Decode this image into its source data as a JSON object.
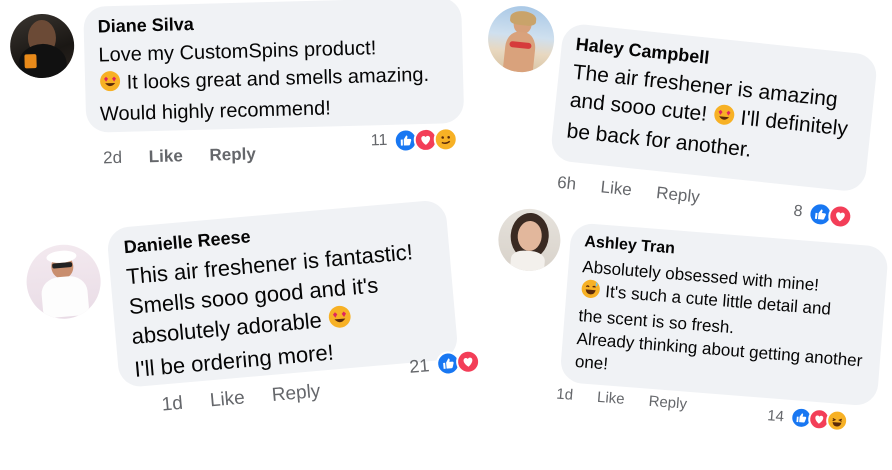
{
  "comments": [
    {
      "name": "Diane Silva",
      "lines": [
        "Love my CustomSpins product!",
        " It looks great and smells amazing.",
        "Would highly recommend!"
      ],
      "time": "2d",
      "like_label": "Like",
      "reply_label": "Reply",
      "reaction_count": "11",
      "reactions": [
        "like",
        "love",
        "wow"
      ]
    },
    {
      "name": "Haley Campbell",
      "lines": [
        "The air freshener is amazing",
        "and sooo cute! ",
        " I'll definitely",
        "be back for another."
      ],
      "time": "6h",
      "like_label": "Like",
      "reply_label": "Reply",
      "reaction_count": "8",
      "reactions": [
        "like",
        "love"
      ]
    },
    {
      "name": "Danielle Reese",
      "lines": [
        "This air freshener is fantastic!",
        "Smells sooo good and it's",
        "absolutely adorable ",
        "I'll be ordering more!"
      ],
      "time": "1d",
      "like_label": "Like",
      "reply_label": "Reply",
      "reaction_count": "21",
      "reactions": [
        "like",
        "love"
      ]
    },
    {
      "name": "Ashley Tran",
      "lines": [
        "Absolutely obsessed with mine!",
        " It's such a cute little detail and",
        "the scent is so fresh.",
        "Already thinking about getting another",
        "one!"
      ],
      "time": "1d",
      "like_label": "Like",
      "reply_label": "Reply",
      "reaction_count": "14",
      "reactions": [
        "like",
        "love",
        "haha"
      ]
    }
  ],
  "colors": {
    "bubble": "#f0f2f5",
    "meta_text": "#65676b",
    "like_blue": "#1877f2",
    "love_red": "#f33e58",
    "emoji_yellow": "#f7b125"
  }
}
